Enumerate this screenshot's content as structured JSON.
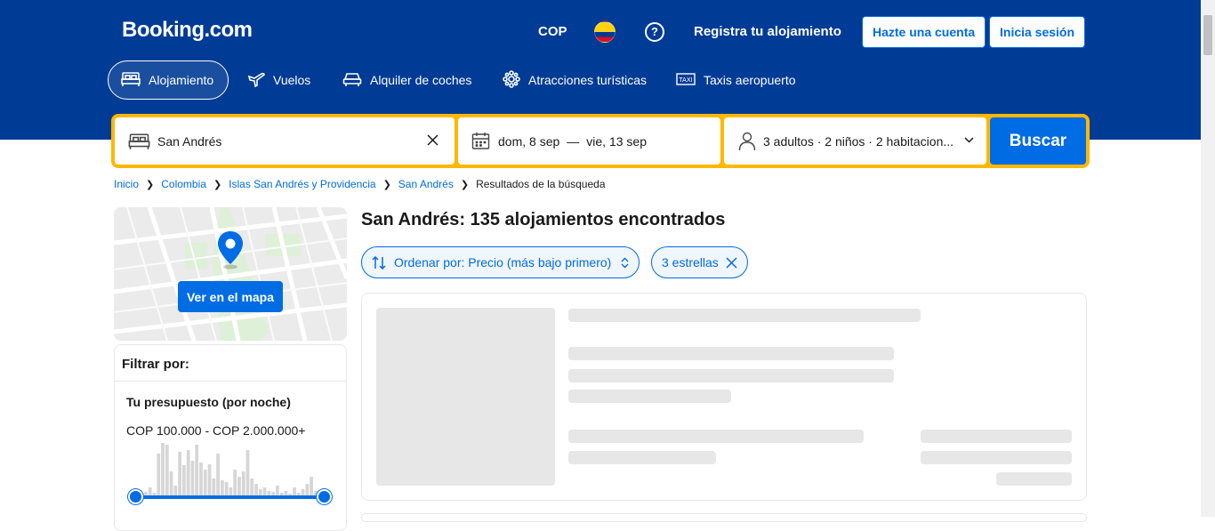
{
  "header": {
    "logo": "Booking.com",
    "currency": "COP",
    "register": "Registra tu alojamiento",
    "signup": "Hazte una cuenta",
    "signin": "Inicia sesión"
  },
  "nav": [
    {
      "label": "Alojamiento",
      "icon": "bed-icon",
      "active": true
    },
    {
      "label": "Vuelos",
      "icon": "plane-icon"
    },
    {
      "label": "Alquiler de coches",
      "icon": "car-icon"
    },
    {
      "label": "Atracciones turísticas",
      "icon": "attractions-icon"
    },
    {
      "label": "Taxis aeropuerto",
      "icon": "taxi-icon"
    }
  ],
  "search": {
    "destination": "San Andrés",
    "checkin": "dom, 8 sep",
    "date_separator": "—",
    "checkout": "vie, 13 sep",
    "guests": "3 adultos · 2 niños · 2 habitacion...",
    "button": "Buscar"
  },
  "breadcrumb": [
    {
      "label": "Inicio",
      "link": true
    },
    {
      "label": "Colombia",
      "link": true
    },
    {
      "label": "Islas San Andrés y Providencia",
      "link": true
    },
    {
      "label": "San Andrés",
      "link": true
    },
    {
      "label": "Resultados de la búsqueda",
      "link": false
    }
  ],
  "map": {
    "button": "Ver en el mapa"
  },
  "filters": {
    "title": "Filtrar por:",
    "budget_title": "Tu presupuesto (por noche)",
    "budget_range": "COP 100.000 - COP 2.000.000+",
    "histogram": [
      2,
      3,
      5,
      10,
      4,
      48,
      60,
      58,
      28,
      12,
      50,
      35,
      52,
      40,
      58,
      38,
      30,
      36,
      20,
      48,
      18,
      16,
      10,
      30,
      22,
      28,
      52,
      20,
      14,
      8,
      10,
      6,
      5,
      12,
      4,
      6,
      3,
      10,
      4,
      8,
      14,
      22,
      6,
      3
    ],
    "range_min": 0,
    "range_max": 1
  },
  "results": {
    "title": "San Andrés: 135 alojamientos encontrados",
    "sort_label": "Ordenar por: Precio (más bajo primero)",
    "stars_chip": "3 estrellas"
  },
  "colors": {
    "brand_blue": "#003b95",
    "action_blue": "#006ce4",
    "search_border": "#ffb700",
    "skeleton": "#e7e7e7"
  }
}
